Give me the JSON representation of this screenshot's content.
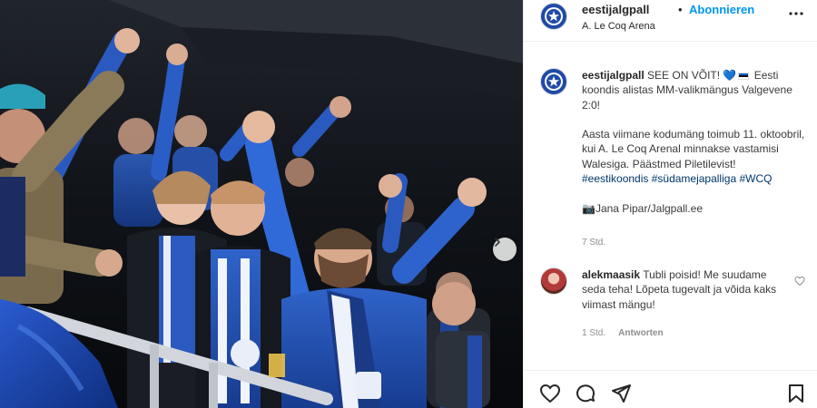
{
  "post": {
    "username": "eestijalgpall",
    "separator": "•",
    "follow_label": "Abonnieren",
    "location": "A. Le Coq Arena",
    "more_icon": "more-dots-icon"
  },
  "caption": {
    "username": "eestijalgpall",
    "line1": "SEE ON VÕIT! ",
    "heart": "💙",
    "flag_label": "EE",
    "line1b": " Eesti koondis alistas MM-valikmängus Valgevene 2:0!",
    "para2": "Aasta viimane kodumäng toimub 11. oktoobril, kui A. Le Coq Arenal minnakse vastamisi Walesiga. Päästmed Piletilevist!",
    "hashtags": "#eestikoondis #südamejapalliga #WCQ",
    "camera_emoji": "📷",
    "photo_credit": "Jana Pipar/Jalgpall.ee",
    "time": "7 Std."
  },
  "comment": {
    "username": "alekmaasik",
    "text": "Tubli poisid! Me suudame seda teha! Lõpeta tugevalt ja võida kaks viimast mängu!",
    "time": "1 Std.",
    "reply_label": "Antworten"
  },
  "colors": {
    "accent": "#0095f6",
    "team_blue": "#1f4aa8",
    "text": "#262626",
    "muted": "#8e8e8e"
  },
  "icons": {
    "like": "heart-outline-icon",
    "comment": "comment-bubble-icon",
    "share": "paper-plane-icon",
    "save": "bookmark-icon",
    "next": "chevron-right-icon"
  }
}
